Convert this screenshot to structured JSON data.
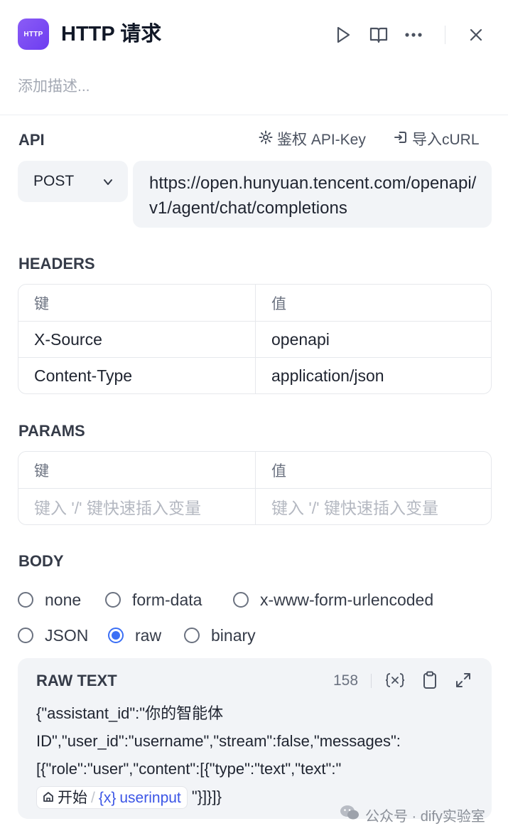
{
  "header": {
    "app_icon_text": "HTTP",
    "title": "HTTP 请求",
    "description_placeholder": "添加描述..."
  },
  "api": {
    "section_title": "API",
    "auth_label": "鉴权 API-Key",
    "import_label": "导入cURL",
    "method": "POST",
    "url": "https://open.hunyuan.tencent.com/openapi/v1/agent/chat/completions"
  },
  "headers": {
    "section_title": "HEADERS",
    "key_header": "键",
    "value_header": "值",
    "rows": [
      {
        "key": "X-Source",
        "value": "openapi"
      },
      {
        "key": "Content-Type",
        "value": "application/json"
      }
    ]
  },
  "params": {
    "section_title": "PARAMS",
    "key_header": "键",
    "value_header": "值",
    "key_placeholder": "键入 '/' 键快速插入变量",
    "value_placeholder": "键入 '/' 键快速插入变量"
  },
  "body": {
    "section_title": "BODY",
    "options": [
      "none",
      "form-data",
      "x-www-form-urlencoded",
      "JSON",
      "raw",
      "binary"
    ],
    "selected": "raw"
  },
  "raw_text": {
    "title": "RAW TEXT",
    "char_count": "158",
    "lines": [
      "{\"assistant_id\":\"你的智能体",
      "ID\",\"user_id\":\"username\",\"stream\":false,\"messages\":",
      "[{\"role\":\"user\",\"content\":[{\"type\":\"text\",\"text\":\""
    ],
    "chip_node": "开始",
    "chip_sep": "/",
    "chip_var_prefix": "{x}",
    "chip_var": "userinput",
    "tail": "\"}]}]}"
  },
  "watermark": "公众号 · dify实验室",
  "colors": {
    "accent": "#3b6ff5",
    "app_icon": "#7c4dff"
  }
}
